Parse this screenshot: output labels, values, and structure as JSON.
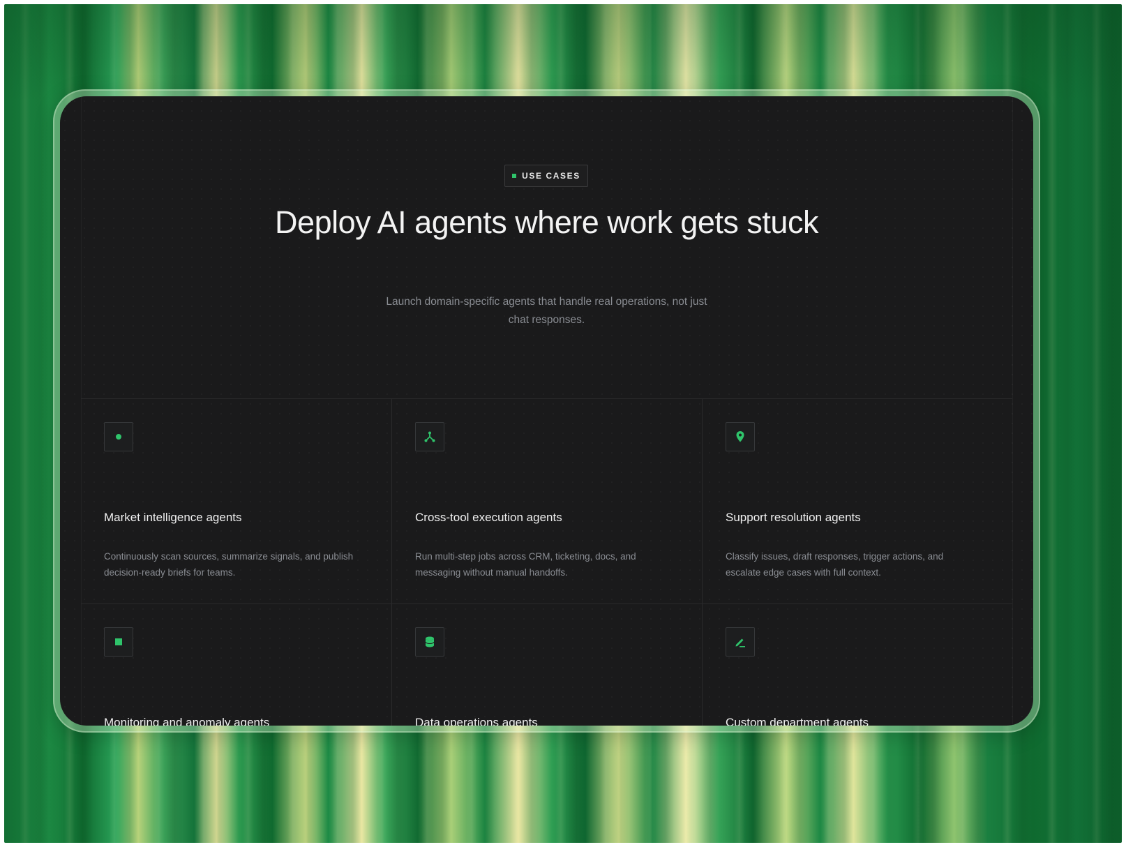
{
  "section": {
    "eyebrow": "USE CASES",
    "title": "Deploy AI agents where work gets stuck",
    "subtitle": "Launch domain-specific agents that handle real operations, not just chat responses."
  },
  "colors": {
    "accent": "#2fc46b",
    "card_background": "#1a1a1b",
    "title_text": "#f3f3f3",
    "muted_text": "#8a8d93"
  },
  "use_cases": [
    {
      "icon": "dot-icon",
      "title": "Market intelligence agents",
      "description": "Continuously scan sources, summarize signals, and publish decision-ready briefs for teams."
    },
    {
      "icon": "branch-icon",
      "title": "Cross-tool execution agents",
      "description": "Run multi-step jobs across CRM, ticketing, docs, and messaging without manual handoffs."
    },
    {
      "icon": "pin-icon",
      "title": "Support resolution agents",
      "description": "Classify issues, draft responses, trigger actions, and escalate edge cases with full context."
    },
    {
      "icon": "square-icon",
      "title": "Monitoring and anomaly agents",
      "description": ""
    },
    {
      "icon": "database-icon",
      "title": "Data operations agents",
      "description": ""
    },
    {
      "icon": "pencil-icon",
      "title": "Custom department agents",
      "description": ""
    }
  ]
}
